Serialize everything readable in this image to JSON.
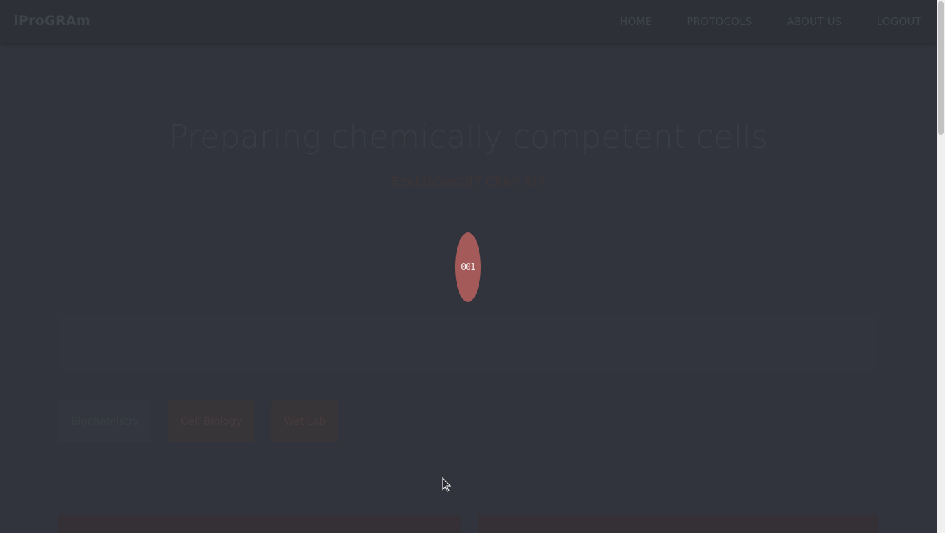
{
  "navbar": {
    "brand": "iProGRAm",
    "links": [
      "HOME",
      "PROTOCOLS",
      "ABOUT US",
      "LOGOUT"
    ]
  },
  "hero": {
    "title": "Preparing chemically competent cells",
    "subtitle": "Ezekiabesc87 Chen Xin"
  },
  "loader": {
    "text": "001"
  },
  "tags": [
    "Biochemistry",
    "Cell Biology",
    "Wet Lab"
  ],
  "colors": {
    "background": "#31343c",
    "navbar": "#2d3037",
    "loader": "#a45a59"
  },
  "icons": {
    "cursor": "mouse-pointer-icon"
  }
}
